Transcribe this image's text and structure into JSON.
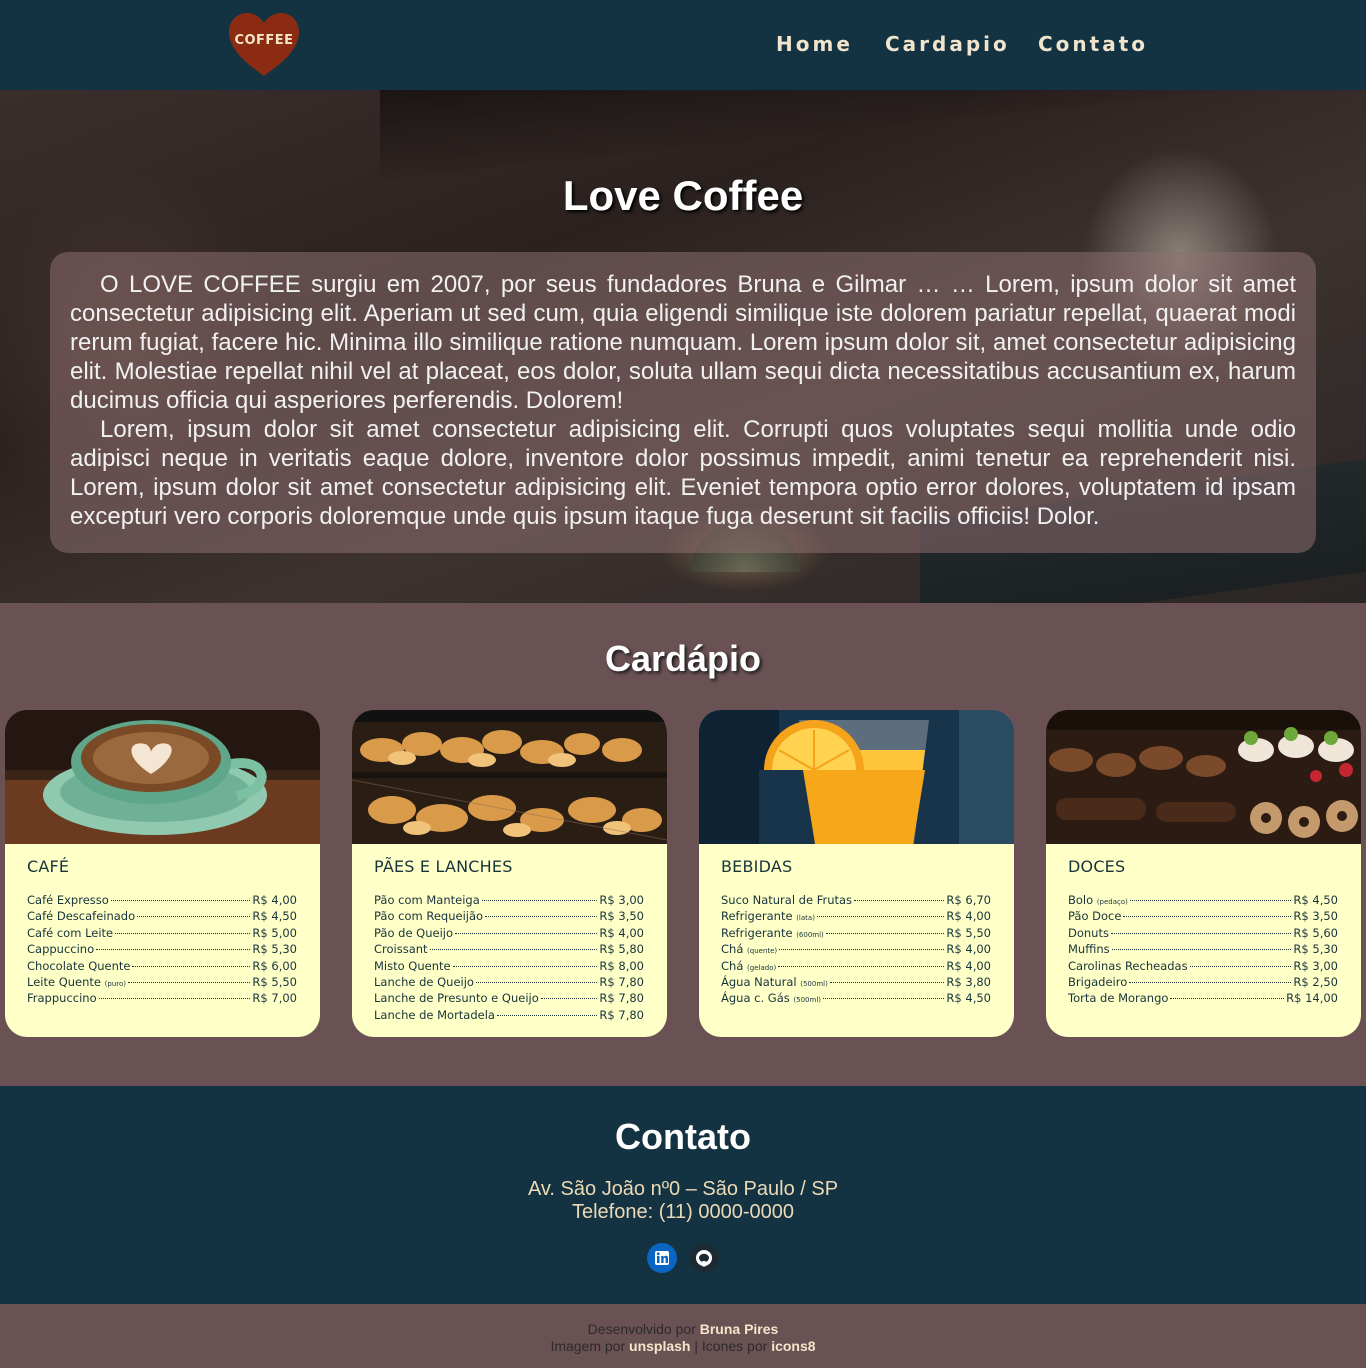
{
  "header": {
    "logo_text": "COFFEE",
    "nav": [
      "Home",
      "Cardapio",
      "Contato"
    ]
  },
  "hero": {
    "title": "Love Coffee",
    "paragraphs": [
      "O LOVE COFFEE surgiu em 2007, por seus fundadores Bruna e Gilmar … … Lorem, ipsum dolor sit amet consectetur adipisicing elit. Aperiam ut sed cum, quia eligendi similique iste dolorem pariatur repellat, quaerat modi rerum fugiat, facere hic. Minima illo similique ratione numquam. Lorem ipsum dolor sit, amet consectetur adipisicing elit. Molestiae repellat nihil vel at placeat, eos dolor, soluta ullam sequi dicta necessitatibus accusantium ex, harum ducimus officia qui asperiores perferendis. Dolorem!",
      "Lorem, ipsum dolor sit amet consectetur adipisicing elit. Corrupti quos voluptates sequi mollitia unde odio adipisci neque in veritatis eaque dolore, inventore dolor possimus impedit, animi tenetur ea reprehenderit nisi. Lorem, ipsum dolor sit amet consectetur adipisicing elit. Eveniet tempora optio error dolores, voluptatem id ipsam excepturi vero corporis doloremque unde quis ipsum itaque fuga deserunt sit facilis officiis! Dolor."
    ]
  },
  "menu": {
    "title": "Cardápio",
    "cards": [
      {
        "title": "CAFÉ",
        "image": "coffee-cup",
        "items": [
          {
            "name": "Café Expresso",
            "note": "",
            "price": "R$ 4,00"
          },
          {
            "name": "Café Descafeinado",
            "note": "",
            "price": "R$ 4,50"
          },
          {
            "name": "Café com Leite",
            "note": "",
            "price": "R$ 5,00"
          },
          {
            "name": "Cappuccino",
            "note": "",
            "price": "R$ 5,30"
          },
          {
            "name": "Chocolate Quente",
            "note": "",
            "price": "R$ 6,00"
          },
          {
            "name": "Leite Quente",
            "note": "(puro)",
            "price": "R$ 5,50"
          },
          {
            "name": "Frappuccino",
            "note": "",
            "price": "R$ 7,00"
          }
        ]
      },
      {
        "title": "PÃES E LANCHES",
        "image": "bread-display",
        "items": [
          {
            "name": "Pão com Manteiga",
            "note": "",
            "price": "R$ 3,00"
          },
          {
            "name": "Pão com Requeijão",
            "note": "",
            "price": "R$ 3,50"
          },
          {
            "name": "Pão de Queijo",
            "note": "",
            "price": "R$ 4,00"
          },
          {
            "name": "Croissant",
            "note": "",
            "price": "R$ 5,80"
          },
          {
            "name": "Misto Quente",
            "note": "",
            "price": "R$ 8,00"
          },
          {
            "name": "Lanche de Queijo",
            "note": "",
            "price": "R$ 7,80"
          },
          {
            "name": "Lanche de Presunto e Queijo",
            "note": "",
            "price": "R$ 7,80"
          },
          {
            "name": "Lanche de Mortadela",
            "note": "",
            "price": "R$ 7,80"
          }
        ]
      },
      {
        "title": "BEBIDAS",
        "image": "orange-juice",
        "items": [
          {
            "name": "Suco Natural de Frutas",
            "note": "",
            "price": "R$ 6,70"
          },
          {
            "name": "Refrigerante",
            "note": "(lata)",
            "price": "R$ 4,00"
          },
          {
            "name": "Refrigerante",
            "note": "(600ml)",
            "price": "R$ 5,50"
          },
          {
            "name": "Chá",
            "note": "(quente)",
            "price": "R$ 4,00"
          },
          {
            "name": "Chá",
            "note": "(gelado)",
            "price": "R$ 4,00"
          },
          {
            "name": "Água Natural",
            "note": "(500ml)",
            "price": "R$ 3,80"
          },
          {
            "name": "Água c. Gás",
            "note": "(500ml)",
            "price": "R$ 4,50"
          }
        ]
      },
      {
        "title": "DOCES",
        "image": "pastry-display",
        "items": [
          {
            "name": "Bolo",
            "note": "(pedaço)",
            "price": "R$ 4,50"
          },
          {
            "name": "Pão Doce",
            "note": "",
            "price": "R$ 3,50"
          },
          {
            "name": "Donuts",
            "note": "",
            "price": "R$ 5,60"
          },
          {
            "name": "Muffins",
            "note": "",
            "price": "R$ 5,30"
          },
          {
            "name": "Carolinas Recheadas",
            "note": "",
            "price": "R$ 3,00"
          },
          {
            "name": "Brigadeiro",
            "note": "",
            "price": "R$ 2,50"
          },
          {
            "name": "Torta de Morango",
            "note": "",
            "price": "R$ 14,00"
          }
        ]
      }
    ]
  },
  "contact": {
    "title": "Contato",
    "address": "Av. São João nº0 – São Paulo / SP",
    "phone": "Telefone: (11) 0000-0000",
    "social": [
      "linkedin-icon",
      "github-icon"
    ]
  },
  "footer": {
    "dev_prefix": "Desenvolvido por",
    "dev_name": "Bruna Pires",
    "img_prefix": "Imagem por",
    "img_source": "unsplash",
    "separator": "|",
    "icons_prefix": "Icones por",
    "icons_source": "icons8"
  },
  "colors": {
    "header_bg": "#133342",
    "section_bg": "#6a5154",
    "card_bg": "#ffffc8",
    "logo_heart": "#8b2c12",
    "nav_text": "#f1e4cc",
    "contact_text": "#ecd9b6"
  }
}
